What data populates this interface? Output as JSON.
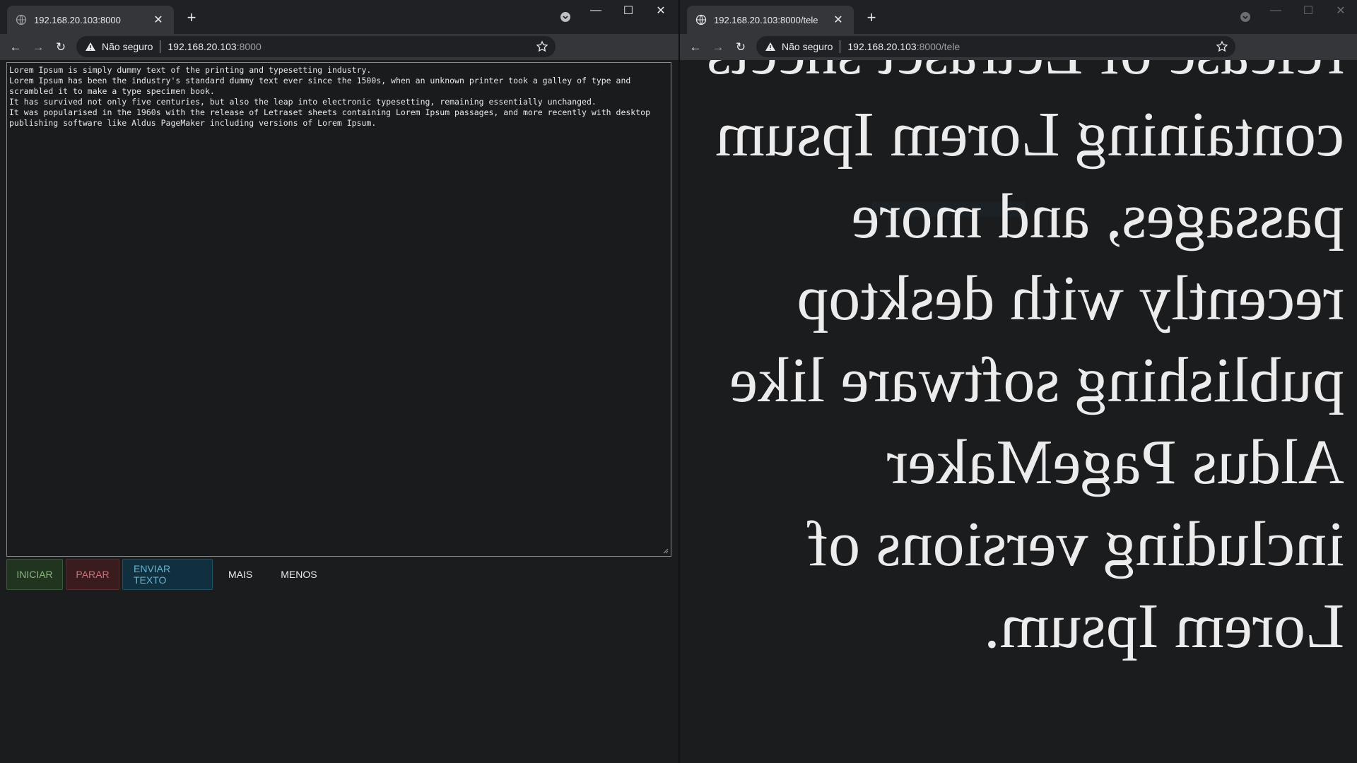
{
  "left_window": {
    "tab": {
      "title": "192.168.20.103:8000"
    },
    "address": {
      "security_label": "Não seguro",
      "host": "192.168.20.103",
      "path": ":8000"
    },
    "editor": {
      "text": "Lorem Ipsum is simply dummy text of the printing and typesetting industry.\nLorem Ipsum has been the industry's standard dummy text ever since the 1500s, when an unknown printer took a galley of type and scrambled it to make a type specimen book.\nIt has survived not only five centuries, but also the leap into electronic typesetting, remaining essentially unchanged.\nIt was popularised in the 1960s with the release of Letraset sheets containing Lorem Ipsum passages, and more recently with desktop publishing software like Aldus PageMaker including versions of Lorem Ipsum."
    },
    "buttons": {
      "start": "INICIAR",
      "stop": "PARAR",
      "send": "ENVIAR TEXTO",
      "more": "MAIS",
      "less": "MENOS"
    }
  },
  "right_window": {
    "tab": {
      "title": "192.168.20.103:8000/tele"
    },
    "address": {
      "security_label": "Não seguro",
      "host": "192.168.20.103",
      "path": ":8000/tele"
    },
    "prompter": {
      "text": "release of Letraset sheets containing Lorem Ipsum passages, and more recently with desktop publishing software like Aldus PageMaker including versions of Lorem Ipsum.",
      "mirrored": true
    }
  },
  "colors": {
    "tabstrip": "#202124",
    "toolbar": "#35363a",
    "page_background": "#1b1c1e",
    "start_text": "#8ab67f",
    "stop_text": "#c9727a",
    "send_text": "#6ab3d1"
  }
}
